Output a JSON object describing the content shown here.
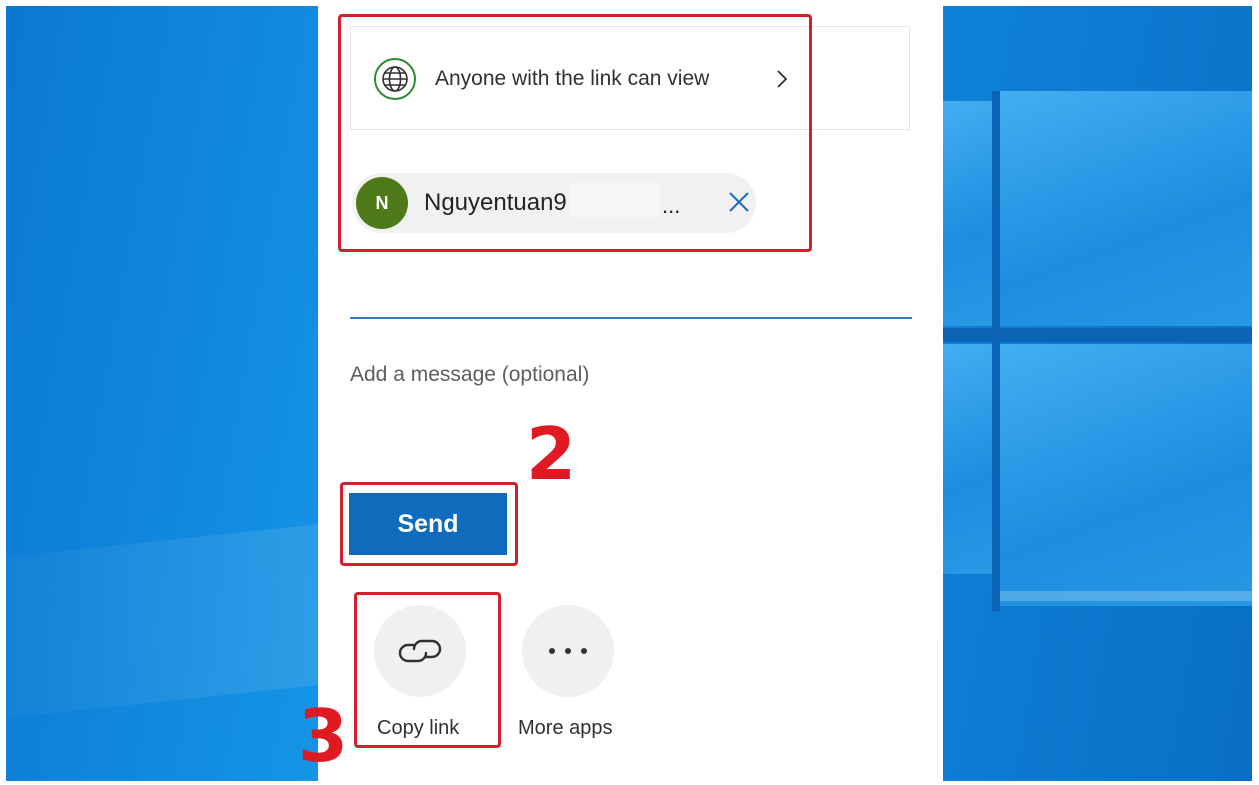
{
  "share_dialog": {
    "link_setting_label": "Anyone with the link can view",
    "recipient": {
      "avatar_initial": "N",
      "name": "Nguyentuan9",
      "overflow": "..."
    },
    "message_placeholder": "Add a message (optional)",
    "send_label": "Send",
    "actions": [
      {
        "label": "Copy link",
        "icon": "link-icon"
      },
      {
        "label": "More apps",
        "icon": "ellipsis-icon"
      }
    ]
  },
  "annotations": {
    "step_2": "2",
    "step_3": "3",
    "highlight_color": "#d21f2b"
  },
  "colors": {
    "send_button": "#0f6cbd",
    "avatar": "#4f7a1a",
    "globe_icon": "#2f8a2f"
  }
}
